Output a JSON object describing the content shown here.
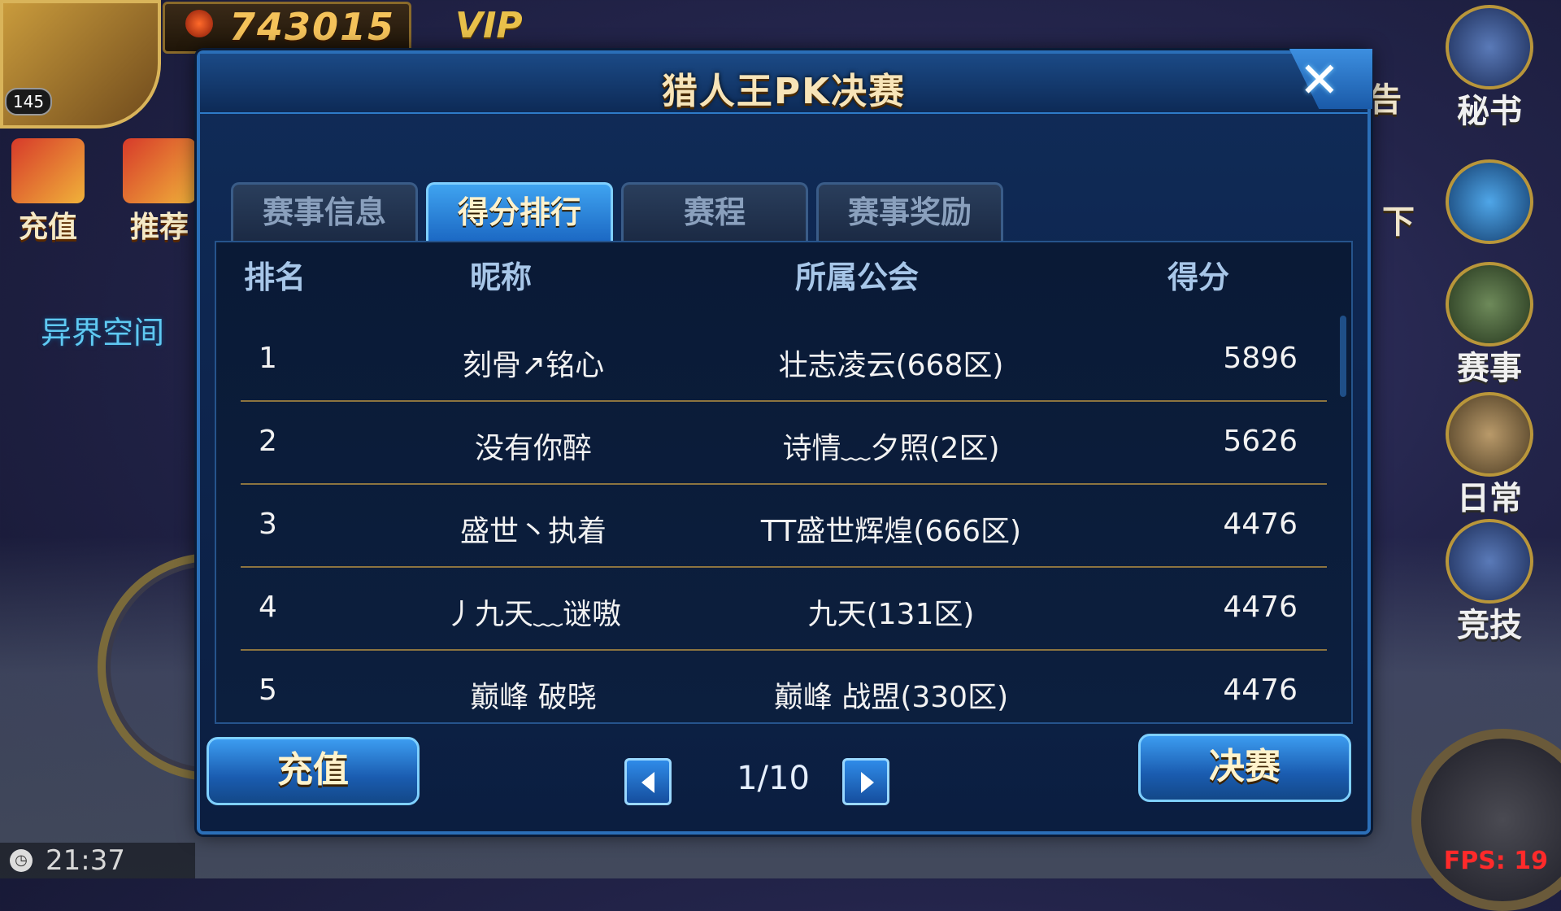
{
  "hud": {
    "level": "145",
    "gold": "743015",
    "vip": "VIP",
    "left_buttons": [
      "充值",
      "推荐"
    ],
    "space_label": "异界空间",
    "clock": "21:37",
    "right_buttons": [
      "秘书",
      "赛事",
      "日常",
      "竞技"
    ],
    "side_peek_1": "告",
    "side_peek_2": "下",
    "fps": "FPS: 19"
  },
  "dialog": {
    "title": "猎人王PK决赛",
    "close_symbol": "✕",
    "tabs": [
      {
        "label": "赛事信息",
        "active": false
      },
      {
        "label": "得分排行",
        "active": true
      },
      {
        "label": "赛程",
        "active": false
      },
      {
        "label": "赛事奖励",
        "active": false
      }
    ],
    "table": {
      "headers": {
        "rank": "排名",
        "name": "昵称",
        "guild": "所属公会",
        "score": "得分"
      },
      "rows": [
        {
          "rank": "1",
          "name": "刻骨↗铭心",
          "guild": "壮志凌云(668区)",
          "score": "5896"
        },
        {
          "rank": "2",
          "name": "没有你醉",
          "guild": "诗情﹏夕照(2区)",
          "score": "5626"
        },
        {
          "rank": "3",
          "name": "盛世丶执着",
          "guild": "TT盛世辉煌(666区)",
          "score": "4476"
        },
        {
          "rank": "4",
          "name": "丿九天﹏谜嗷",
          "guild": "九天(131区)",
          "score": "4476"
        },
        {
          "rank": "5",
          "name": "巅峰 破晓",
          "guild": "巅峰 战盟(330区)",
          "score": "4476"
        }
      ]
    },
    "recharge_label": "充值",
    "final_label": "决赛",
    "page": "1/10"
  },
  "colors": {
    "accent": "#2b6fb8",
    "title_text": "#f7e4b8",
    "row_divider": "#8c7440"
  }
}
